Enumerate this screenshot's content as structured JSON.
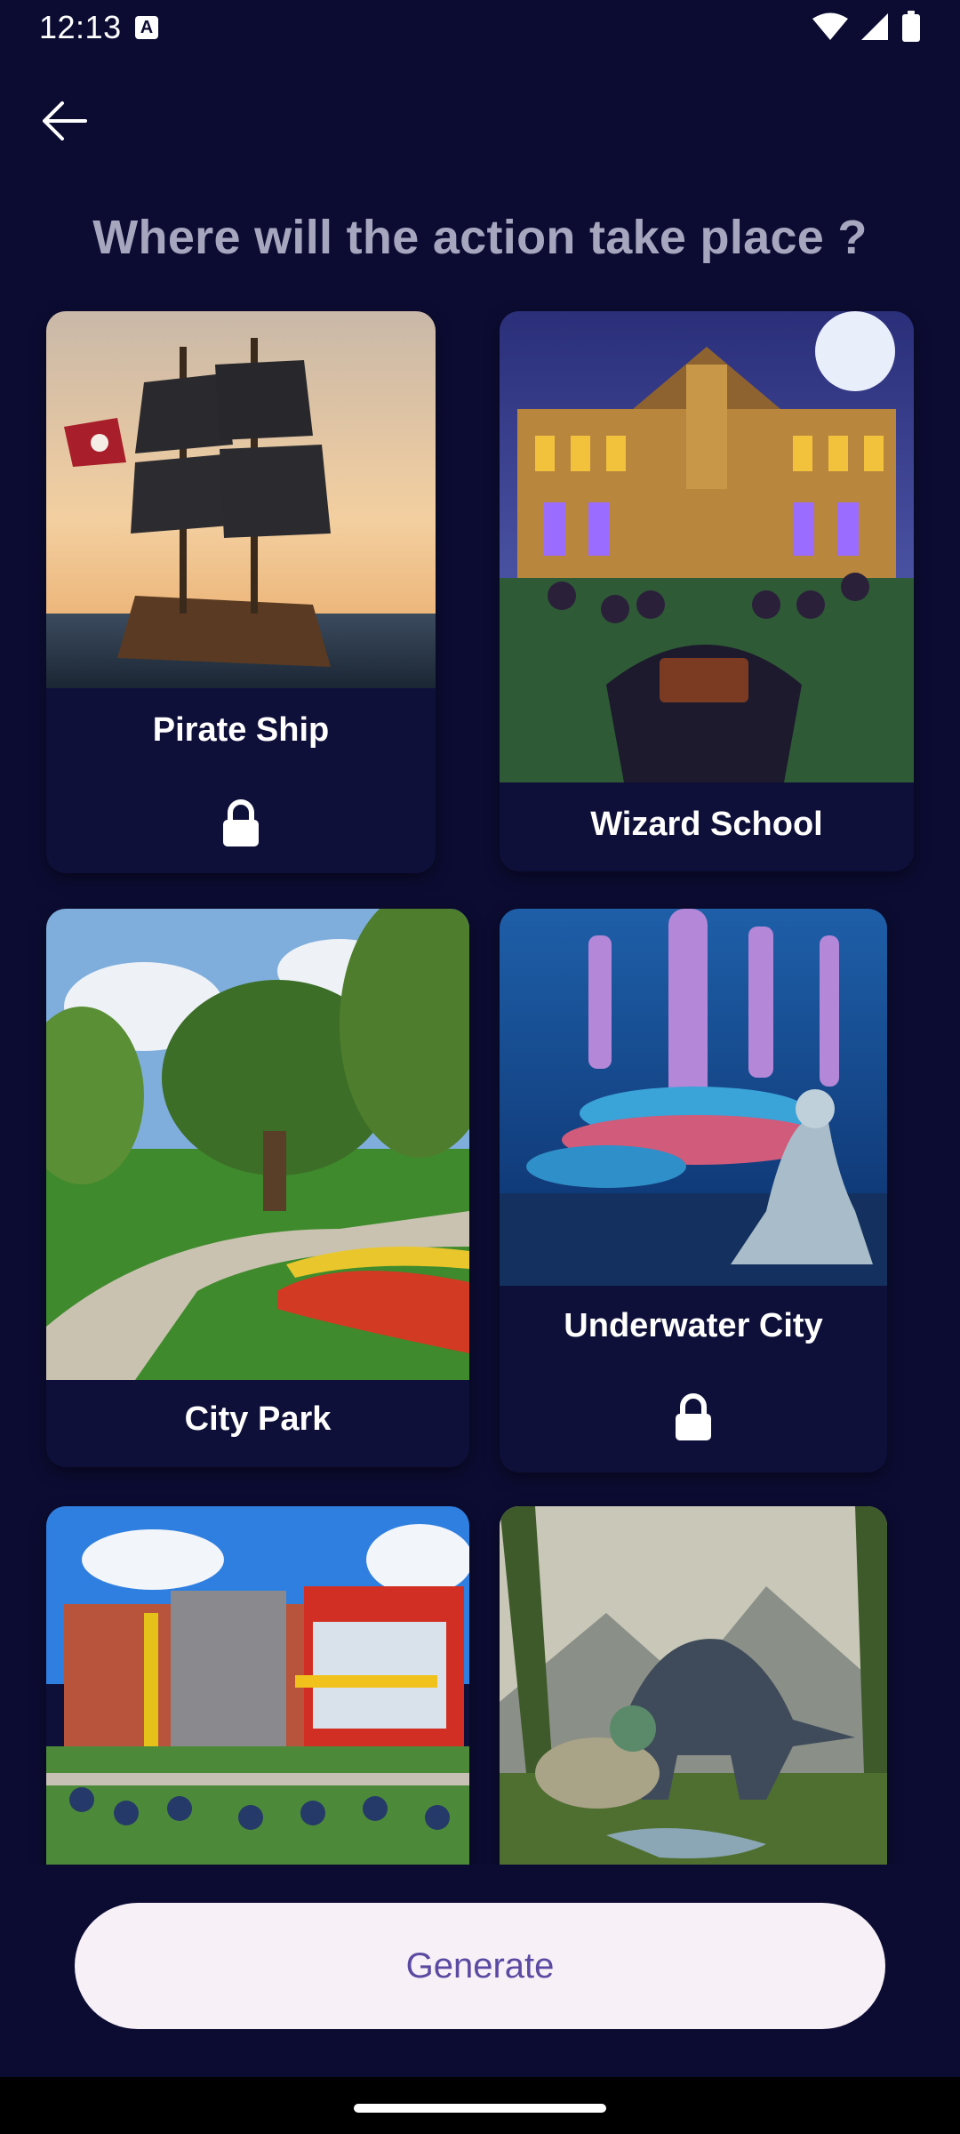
{
  "status_bar": {
    "time": "12:13",
    "icons": [
      "a-notification-icon",
      "wifi-icon",
      "signal-icon",
      "battery-icon"
    ]
  },
  "header": {
    "back_icon": "arrow-left-icon",
    "title": "Where will the action take place ?"
  },
  "colors": {
    "background": "#0c0c33",
    "card_background": "#0f1039",
    "title": "#a7a6bf",
    "button_background": "#f7f0f7",
    "button_text": "#5b4aa2"
  },
  "cards": [
    {
      "label": "Pirate Ship",
      "locked": true,
      "image": "pirate-ship-image"
    },
    {
      "label": "Wizard School",
      "locked": false,
      "image": "wizard-school-image"
    },
    {
      "label": "City Park",
      "locked": false,
      "image": "city-park-image"
    },
    {
      "label": "Underwater City",
      "locked": true,
      "image": "underwater-city-image"
    },
    {
      "label": "",
      "locked": false,
      "image": "school-image"
    },
    {
      "label": "",
      "locked": false,
      "image": "dinosaur-land-image"
    }
  ],
  "generate": {
    "label": "Generate"
  }
}
